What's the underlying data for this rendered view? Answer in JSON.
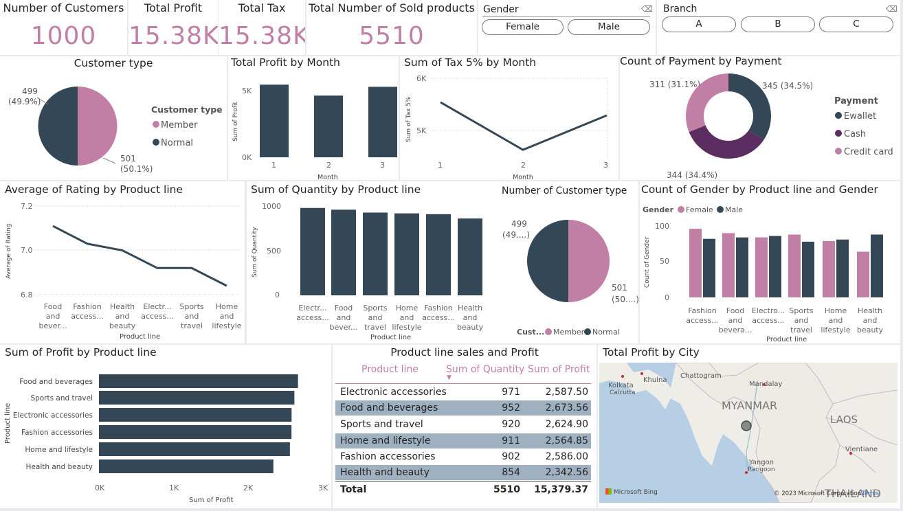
{
  "kpis": {
    "customers": {
      "label": "Number of Customers",
      "value": "1000"
    },
    "profit": {
      "label": "Total Profit",
      "value": "15.38K"
    },
    "tax": {
      "label": "Total Tax",
      "value": "15.38K"
    },
    "sold": {
      "label": "Total Number of Sold products",
      "value": "5510"
    }
  },
  "slicers": {
    "gender": {
      "title": "Gender",
      "options": [
        "Female",
        "Male"
      ]
    },
    "branch": {
      "title": "Branch",
      "options": [
        "A",
        "B",
        "C"
      ]
    }
  },
  "colors": {
    "pink": "#c27fa6",
    "navy": "#344756",
    "purple": "#5c2d61",
    "kpi": "#c27fa6"
  },
  "charts": {
    "customer_type": {
      "title": "Customer type",
      "legend_title": "Customer type",
      "legend": [
        "Member",
        "Normal"
      ],
      "label_normal": "499",
      "label_normal_pct": "(49.9%)",
      "label_member": "501",
      "label_member_pct": "(50.1%)"
    },
    "profit_month": {
      "title": "Total Profit by Month",
      "ylabel": "Sum of Profit",
      "xlabel": "Month",
      "yticks": [
        "5K",
        "0K"
      ],
      "xticks": [
        "1",
        "2",
        "3"
      ]
    },
    "tax_month": {
      "title": "Sum of Tax 5% by Month",
      "ylabel": "Sum of Tax 5%",
      "xlabel": "Month",
      "yticks": [
        "6K",
        "5K"
      ],
      "xticks": [
        "1",
        "2",
        "3"
      ]
    },
    "payment": {
      "title": "Count of Payment by Payment",
      "legend_title": "Payment",
      "legend": [
        "Ewallet",
        "Cash",
        "Credit card"
      ],
      "label_ewallet": "345 (34.5%)",
      "label_cash": "344 (34.4%)",
      "label_credit": "311 (31.1%)"
    },
    "rating": {
      "title": "Average of Rating by Product line",
      "ylabel": "Average of Rating",
      "xlabel": "Product line",
      "yticks": [
        "7.2",
        "7.0",
        "6.8"
      ],
      "xticks": [
        [
          "Food",
          "and",
          "bever..."
        ],
        [
          "Fashion",
          "access..."
        ],
        [
          "Health",
          "and",
          "beauty"
        ],
        [
          "Electr...",
          "access..."
        ],
        [
          "Sports",
          "and",
          "travel"
        ],
        [
          "Home",
          "and",
          "lifestyle"
        ]
      ]
    },
    "quantity": {
      "title": "Sum of Quantity by Product line",
      "ylabel": "Sum of Quantity",
      "xlabel": "Product line",
      "yticks": [
        "1000",
        "500",
        "0"
      ],
      "xticks": [
        [
          "Electr...",
          "access..."
        ],
        [
          "Food",
          "and",
          "bever..."
        ],
        [
          "Sports",
          "and",
          "travel"
        ],
        [
          "Home",
          "and",
          "lifestyle"
        ],
        [
          "Fashion",
          "access..."
        ],
        [
          "Health",
          "and",
          "beauty"
        ]
      ]
    },
    "cust_type2": {
      "title": "Number of Customer type",
      "legend_title": "Cust...",
      "legend": [
        "Member",
        "Normal"
      ],
      "label_normal": "499",
      "label_normal_pct": "(49....)",
      "label_member": "501",
      "label_member_pct": "(50....)"
    },
    "gender_line": {
      "title": "Count of Gender by Product line and Gender",
      "legend_title": "Gender",
      "legend": [
        "Female",
        "Male"
      ],
      "ylabel": "Count of Gender",
      "xlabel": "Product line",
      "yticks": [
        "100",
        "50",
        "0"
      ],
      "xticks": [
        [
          "Fashion",
          "access..."
        ],
        [
          "Food",
          "and",
          "bevera..."
        ],
        [
          "Electro...",
          "access..."
        ],
        [
          "Sports",
          "and",
          "travel"
        ],
        [
          "Home",
          "and",
          "lifestyle"
        ],
        [
          "Health",
          "and",
          "beauty"
        ]
      ]
    },
    "profit_line": {
      "title": "Sum of Profit by Product line",
      "ylabel": "Product line",
      "xlabel": "Sum of Profit",
      "xticks": [
        "0K",
        "1K",
        "2K",
        "3K"
      ],
      "categories": [
        "Food and beverages",
        "Sports and travel",
        "Electronic accessories",
        "Fashion accessories",
        "Home and lifestyle",
        "Health and beauty"
      ]
    },
    "city": {
      "title": "Total Profit by City",
      "labels": [
        "Khulna",
        "Kolkata",
        "Calcutta",
        "Chattogram",
        "Mandalay",
        "MYANMAR",
        "LAOS",
        "Vientiane",
        "Yangon",
        "Rangoon",
        "THAILAND"
      ],
      "bing": "Microsoft Bing",
      "copyright": "© 2023 Microsoft Corporation",
      "terms": "Terms"
    }
  },
  "table": {
    "title": "Product line sales and Profit",
    "headers": [
      "Product line",
      "Sum of Quantity",
      "Sum of Profit"
    ],
    "rows": [
      [
        "Electronic accessories",
        "971",
        "2,587.50"
      ],
      [
        "Food and beverages",
        "952",
        "2,673.56"
      ],
      [
        "Sports and travel",
        "920",
        "2,624.90"
      ],
      [
        "Home and lifestyle",
        "911",
        "2,564.85"
      ],
      [
        "Fashion accessories",
        "902",
        "2,586.00"
      ],
      [
        "Health and beauty",
        "854",
        "2,342.56"
      ]
    ],
    "total": [
      "Total",
      "5510",
      "15,379.37"
    ]
  },
  "chart_data": [
    {
      "type": "pie",
      "title": "Customer type",
      "categories": [
        "Member",
        "Normal"
      ],
      "values": [
        501,
        499
      ]
    },
    {
      "type": "bar",
      "title": "Total Profit by Month",
      "xlabel": "Month",
      "ylabel": "Sum of Profit",
      "categories": [
        "1",
        "2",
        "3"
      ],
      "values": [
        5450,
        4630,
        5290
      ],
      "ylim": [
        0,
        6000
      ]
    },
    {
      "type": "line",
      "title": "Sum of Tax 5% by Month",
      "xlabel": "Month",
      "ylabel": "Sum of Tax 5%",
      "categories": [
        "1",
        "2",
        "3"
      ],
      "values": [
        5540,
        4630,
        5290
      ],
      "ylim": [
        4500,
        6000
      ]
    },
    {
      "type": "pie",
      "title": "Count of Payment by Payment",
      "categories": [
        "Ewallet",
        "Cash",
        "Credit card"
      ],
      "values": [
        345,
        344,
        311
      ]
    },
    {
      "type": "line",
      "title": "Average of Rating by Product line",
      "xlabel": "Product line",
      "ylabel": "Average of Rating",
      "categories": [
        "Food and beverages",
        "Fashion accessories",
        "Health and beauty",
        "Electronic accessories",
        "Sports and travel",
        "Home and lifestyle"
      ],
      "values": [
        7.11,
        7.03,
        7.0,
        6.92,
        6.92,
        6.84
      ],
      "ylim": [
        6.8,
        7.2
      ]
    },
    {
      "type": "bar",
      "title": "Sum of Quantity by Product line",
      "xlabel": "Product line",
      "ylabel": "Sum of Quantity",
      "categories": [
        "Electronic accessories",
        "Food and beverages",
        "Sports and travel",
        "Home and lifestyle",
        "Fashion accessories",
        "Health and beauty"
      ],
      "values": [
        971,
        952,
        920,
        911,
        902,
        854
      ],
      "ylim": [
        0,
        1000
      ]
    },
    {
      "type": "pie",
      "title": "Number of Customer type",
      "categories": [
        "Member",
        "Normal"
      ],
      "values": [
        501,
        499
      ]
    },
    {
      "type": "bar",
      "title": "Count of Gender by Product line and Gender",
      "xlabel": "Product line",
      "ylabel": "Count of Gender",
      "categories": [
        "Fashion accessories",
        "Food and beverages",
        "Electronic accessories",
        "Sports and travel",
        "Home and lifestyle",
        "Health and beauty"
      ],
      "series": [
        {
          "name": "Female",
          "values": [
            96,
            90,
            84,
            88,
            79,
            64
          ]
        },
        {
          "name": "Male",
          "values": [
            82,
            84,
            86,
            78,
            81,
            88
          ]
        }
      ],
      "ylim": [
        0,
        110
      ]
    },
    {
      "type": "bar",
      "title": "Sum of Profit by Product line",
      "xlabel": "Sum of Profit",
      "ylabel": "Product line",
      "categories": [
        "Food and beverages",
        "Sports and travel",
        "Electronic accessories",
        "Fashion accessories",
        "Home and lifestyle",
        "Health and beauty"
      ],
      "values": [
        2673.56,
        2624.9,
        2587.5,
        2586.0,
        2564.85,
        2342.56
      ],
      "xlim": [
        0,
        3000
      ]
    }
  ]
}
